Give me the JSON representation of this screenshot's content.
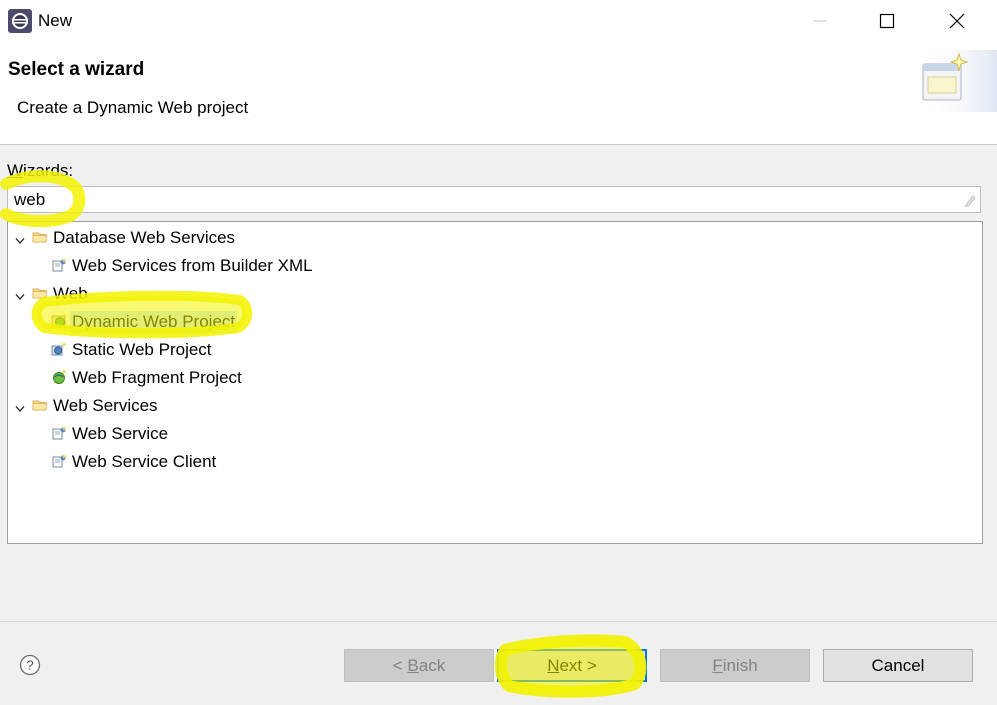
{
  "window": {
    "title": "New",
    "controls": [
      "minimize-icon",
      "maximize-icon",
      "close-icon"
    ]
  },
  "header": {
    "title": "Select a wizard",
    "description": "Create a Dynamic Web project"
  },
  "wizards": {
    "label_mnemonic": "W",
    "label_rest": "izards:",
    "filter_value": "web"
  },
  "tree": {
    "items": [
      {
        "label": "Database Web Services",
        "type": "folder",
        "expanded": true,
        "level": 0
      },
      {
        "label": "Web Services from Builder XML",
        "type": "wizard",
        "icon": "web-service-wizard-icon",
        "level": 1
      },
      {
        "label": "Web",
        "type": "folder",
        "expanded": true,
        "level": 0
      },
      {
        "label": "Dynamic Web Project",
        "type": "wizard",
        "icon": "dynamic-web-project-icon",
        "level": 1,
        "selected": true
      },
      {
        "label": "Static Web Project",
        "type": "wizard",
        "icon": "static-web-project-icon",
        "level": 1
      },
      {
        "label": "Web Fragment Project",
        "type": "wizard",
        "icon": "web-fragment-project-icon",
        "level": 1
      },
      {
        "label": "Web Services",
        "type": "folder",
        "expanded": true,
        "level": 0
      },
      {
        "label": "Web Service",
        "type": "wizard",
        "icon": "web-service-wizard-icon",
        "level": 1
      },
      {
        "label": "Web Service Client",
        "type": "wizard",
        "icon": "web-service-wizard-icon",
        "level": 1
      }
    ]
  },
  "footer": {
    "back": {
      "pre": "< ",
      "mnemonic": "B",
      "post": "ack",
      "enabled": false
    },
    "next": {
      "pre": "",
      "mnemonic": "N",
      "post": "ext >",
      "enabled": true,
      "default": true
    },
    "finish": {
      "pre": "",
      "mnemonic": "F",
      "post": "inish",
      "enabled": false
    },
    "cancel": {
      "label": "Cancel",
      "enabled": true
    }
  },
  "colors": {
    "selection": "#cde8ff",
    "highlighter": "#f2f200",
    "default_button_border": "#0078d7",
    "folder_icon": "#dcb35c"
  }
}
